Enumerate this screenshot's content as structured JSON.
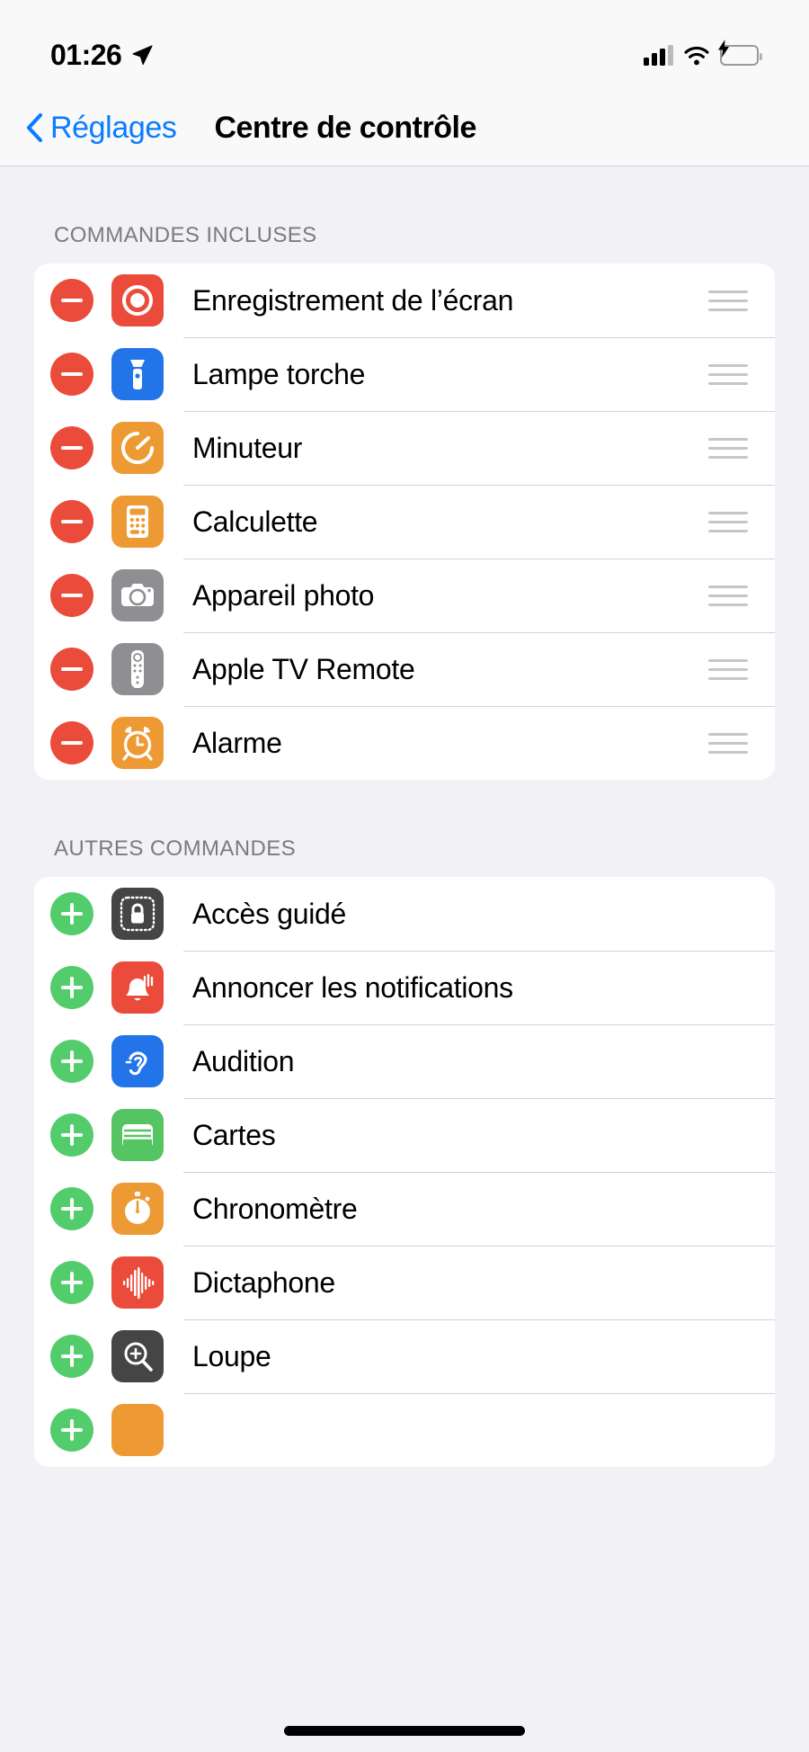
{
  "status_bar": {
    "time": "01:26",
    "location_icon": "location-arrow-icon",
    "cellular_icon": "cellular-signal-icon",
    "wifi_icon": "wifi-icon",
    "battery_icon": "battery-charging-icon"
  },
  "nav": {
    "back_label": "Réglages",
    "back_icon": "chevron-left-icon",
    "title": "Centre de contrôle"
  },
  "sections": [
    {
      "header": "COMMANDES INCLUSES",
      "action": "remove",
      "action_icon": "minus-circle-icon",
      "has_drag_handles": true,
      "items": [
        {
          "label": "Enregistrement de l’écran",
          "icon": "screen-record-icon",
          "color": "#eb4b3a"
        },
        {
          "label": "Lampe torche",
          "icon": "flashlight-icon",
          "color": "#2274e8"
        },
        {
          "label": "Minuteur",
          "icon": "timer-icon",
          "color": "#ee9a34"
        },
        {
          "label": "Calculette",
          "icon": "calculator-icon",
          "color": "#ee9a34"
        },
        {
          "label": "Appareil photo",
          "icon": "camera-icon",
          "color": "#8e8e93"
        },
        {
          "label": "Apple TV Remote",
          "icon": "tv-remote-icon",
          "color": "#8e8e93"
        },
        {
          "label": "Alarme",
          "icon": "alarm-clock-icon",
          "color": "#ee9a34"
        }
      ]
    },
    {
      "header": "AUTRES COMMANDES",
      "action": "add",
      "action_icon": "plus-circle-icon",
      "has_drag_handles": false,
      "items": [
        {
          "label": "Accès guidé",
          "icon": "guided-access-lock-icon",
          "color": "#454545"
        },
        {
          "label": "Annoncer les notifications",
          "icon": "announce-bell-icon",
          "color": "#eb4b3a"
        },
        {
          "label": "Audition",
          "icon": "ear-hearing-icon",
          "color": "#2274e8"
        },
        {
          "label": "Cartes",
          "icon": "wallet-cards-icon",
          "color": "#55c463"
        },
        {
          "label": "Chronomètre",
          "icon": "stopwatch-icon",
          "color": "#ee9a34"
        },
        {
          "label": "Dictaphone",
          "icon": "voice-memo-waveform-icon",
          "color": "#eb4b3a"
        },
        {
          "label": "Loupe",
          "icon": "magnifier-plus-icon",
          "color": "#454545"
        },
        {
          "label": "",
          "icon": "partial-orange-icon",
          "color": "#ee9a34"
        }
      ]
    }
  ],
  "home_indicator": "home-indicator-bar"
}
